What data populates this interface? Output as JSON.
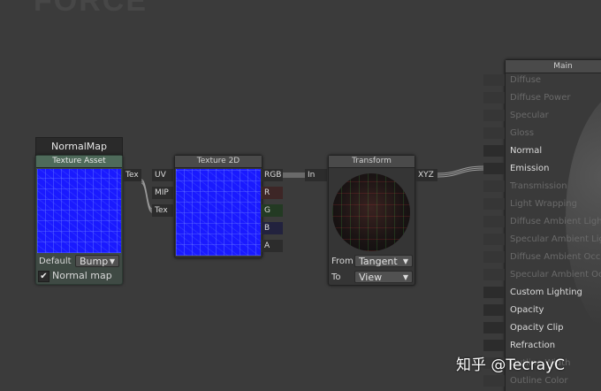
{
  "background_title": "FORCE",
  "nodes": {
    "normal_map": {
      "title": "NormalMap",
      "header": "Texture Asset",
      "default_label": "Default",
      "default_value": "Bump",
      "checkbox_label": "Normal map",
      "checked": true
    },
    "texture2d": {
      "header": "Texture 2D",
      "inputs": [
        "UV",
        "MIP",
        "Tex"
      ],
      "outputs": [
        "RGB",
        "R",
        "G",
        "B",
        "A"
      ]
    },
    "transform": {
      "header": "Transform",
      "input": "In",
      "output": "XYZ",
      "from_label": "From",
      "from_value": "Tangent",
      "to_label": "To",
      "to_value": "View"
    },
    "main": {
      "header": "Main",
      "inputs": [
        {
          "label": "Diffuse",
          "connected": false
        },
        {
          "label": "Diffuse Power",
          "connected": false
        },
        {
          "label": "Specular",
          "connected": false
        },
        {
          "label": "Gloss",
          "connected": false
        },
        {
          "label": "Normal",
          "connected": true
        },
        {
          "label": "Emission",
          "connected": true
        },
        {
          "label": "Transmission",
          "connected": false
        },
        {
          "label": "Light Wrapping",
          "connected": false
        },
        {
          "label": "Diffuse Ambient Light",
          "connected": false
        },
        {
          "label": "Specular Ambient Light",
          "connected": false
        },
        {
          "label": "Diffuse Ambient Occlusion",
          "connected": false
        },
        {
          "label": "Specular Ambient Occlusion",
          "connected": false
        },
        {
          "label": "Custom Lighting",
          "connected": true
        },
        {
          "label": "Opacity",
          "connected": true
        },
        {
          "label": "Opacity Clip",
          "connected": true
        },
        {
          "label": "Refraction",
          "connected": true
        },
        {
          "label": "Outline Width",
          "connected": false
        },
        {
          "label": "Outline Color",
          "connected": false
        }
      ]
    },
    "tex_output_label": "Tex"
  },
  "watermark": "知乎 @TecrayC",
  "colors": {
    "background": "#3b3b3b",
    "asset_header": "#4e6a5a",
    "preview_blue": "#1a1aff",
    "wire": "#9a9a9a"
  }
}
